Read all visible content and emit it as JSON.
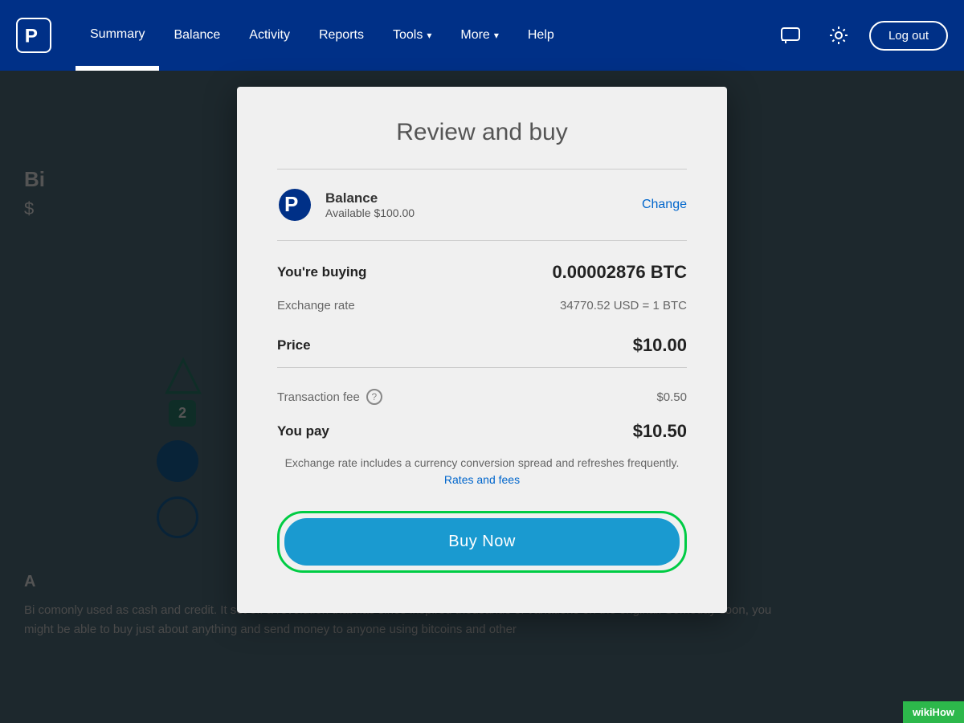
{
  "navbar": {
    "logo_alt": "PayPal",
    "links": [
      {
        "label": "Summary",
        "active": true
      },
      {
        "label": "Balance",
        "active": false
      },
      {
        "label": "Activity",
        "active": false
      },
      {
        "label": "Reports",
        "active": false
      },
      {
        "label": "Tools",
        "active": false,
        "has_chevron": true
      },
      {
        "label": "More",
        "active": false,
        "has_chevron": true
      },
      {
        "label": "Help",
        "active": false
      }
    ],
    "icons": {
      "message": "💬",
      "settings": "⚙"
    },
    "logout_label": "Log out"
  },
  "background": {
    "title": "Bi",
    "subtitle": "$",
    "badge": "2",
    "paragraph_title": "A",
    "paragraph_text": "Bi comonly used as cash and credit. It set off a revolution that has since inspired thousands of variations on the original. Someday soon, you might be able to buy just about anything and send money to anyone using bitcoins and other"
  },
  "modal": {
    "title": "Review and buy",
    "payment_method": {
      "name": "Balance",
      "available": "Available $100.00",
      "change_label": "Change"
    },
    "buying_label": "You're buying",
    "buying_value": "0.00002876 BTC",
    "exchange_rate_label": "Exchange rate",
    "exchange_rate_value": "34770.52 USD = 1 BTC",
    "price_label": "Price",
    "price_value": "$10.00",
    "transaction_fee_label": "Transaction fee",
    "transaction_fee_value": "$0.50",
    "you_pay_label": "You pay",
    "you_pay_value": "$10.50",
    "exchange_note": "Exchange rate includes a currency conversion spread and refreshes frequently.",
    "rates_fees_label": "Rates and fees",
    "buy_now_label": "Buy Now"
  },
  "wikihow": {
    "label": "wikiHow"
  }
}
